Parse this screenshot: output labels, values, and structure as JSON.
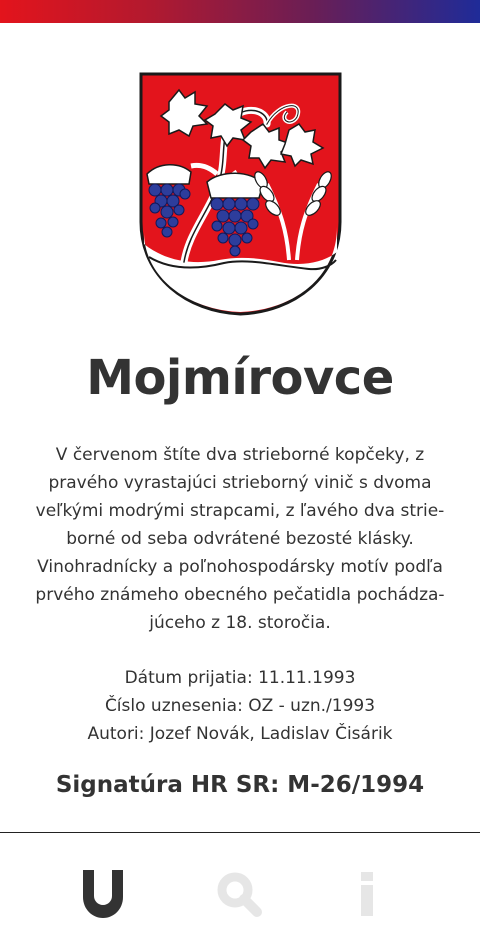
{
  "colors": {
    "accent_red": "#e3141c",
    "accent_blue": "#1f2b98",
    "text": "#333333",
    "inactive_icon": "#e6e6e6"
  },
  "crest": {
    "name": "mojmirovce-coat-of-arms"
  },
  "municipality": {
    "name": "Mojmírovce"
  },
  "description": {
    "lines": [
      "V červenom štíte dva strieborné kopčeky, z",
      "pravého vyrastajúci strieborný vinič s dvoma",
      "veľkými modrými strapcami, z ľavého dva strie-",
      "borné od seba odvrátené bezosté klásky.",
      "Vinohradnícky a poľnohospodársky motív podľa",
      "prvého známeho obecného pečatidla pochádza-",
      "júceho z 18. storočia."
    ]
  },
  "details": {
    "adoption_date": "Dátum prijatia: 11.11.1993",
    "resolution_number": "Číslo uznesenia: OZ - uzn./1993",
    "authors": "Autori: Jozef Novák, Ladislav Čisárik"
  },
  "signature": "Signatúra HR SR: M-26/1994",
  "nav": {
    "items": [
      {
        "id": "crest",
        "icon": "shield-icon",
        "active": true
      },
      {
        "id": "search",
        "icon": "search-icon",
        "active": false
      },
      {
        "id": "info",
        "icon": "info-icon",
        "active": false
      }
    ]
  }
}
